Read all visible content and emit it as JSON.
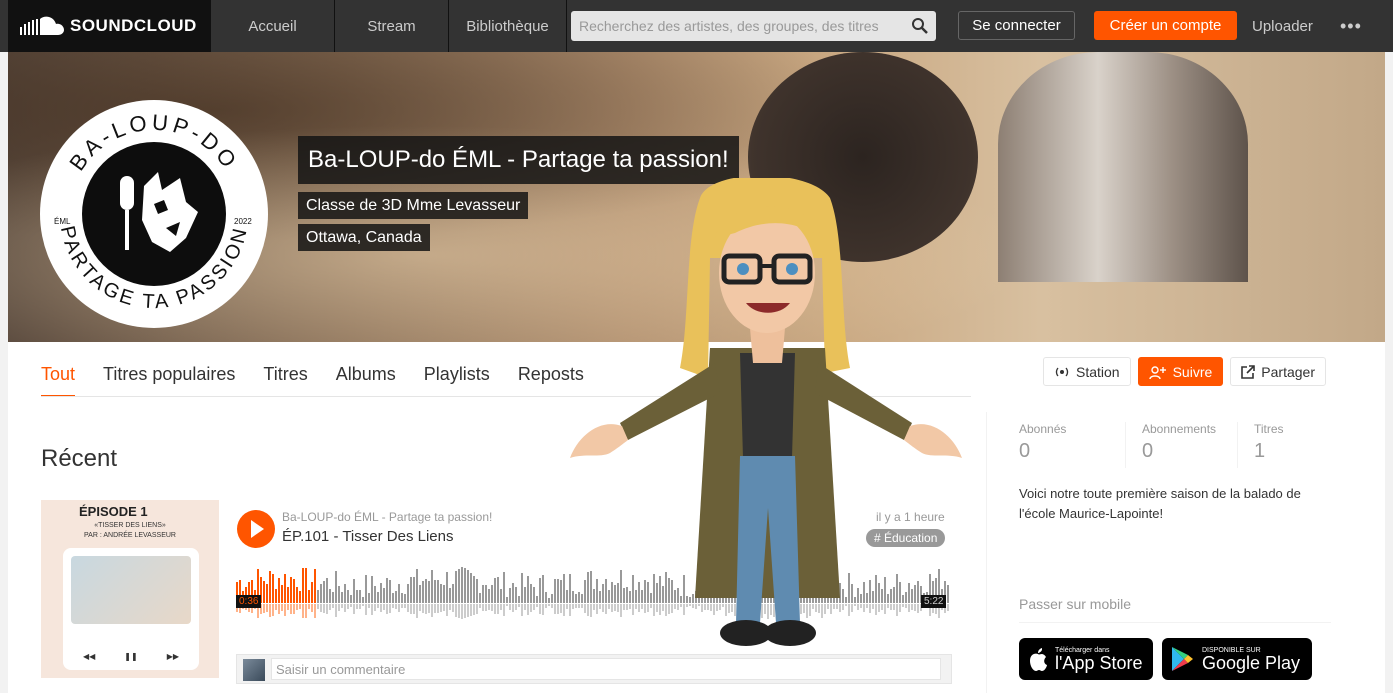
{
  "colors": {
    "accent": "#ff5500",
    "header_bg": "#333333",
    "logo_bg": "#111111"
  },
  "header": {
    "brand": "SOUNDCLOUD",
    "nav": [
      "Accueil",
      "Stream",
      "Bibliothèque"
    ],
    "search_placeholder": "Recherchez des artistes, des groupes, des titres",
    "login": "Se connecter",
    "signup": "Créer un compte",
    "upload": "Uploader",
    "more": "•••"
  },
  "banner": {
    "title": "Ba-LOUP-do ÉML - Partage ta passion!",
    "subtitle": "Classe de 3D Mme Levasseur",
    "location": "Ottawa, Canada",
    "logo": {
      "ring_top": "BA-LOUP-DO",
      "ring_bottom": "PARTAGE TA PASSION",
      "left": "ÉML",
      "right": "2022"
    }
  },
  "tabs": [
    {
      "label": "Tout",
      "active": true
    },
    {
      "label": "Titres populaires"
    },
    {
      "label": "Titres"
    },
    {
      "label": "Albums"
    },
    {
      "label": "Playlists"
    },
    {
      "label": "Reposts"
    }
  ],
  "actions": {
    "station": "Station",
    "follow": "Suivre",
    "share": "Partager"
  },
  "recent": {
    "heading": "Récent",
    "track": {
      "user": "Ba-LOUP-do ÉML - Partage ta passion!",
      "title": "ÉP.101 - Tisser Des Liens",
      "posted": "il y a 1 heure",
      "tag": "# Éducation",
      "current": "0:36",
      "duration": "5:22",
      "progress": 0.11,
      "artwork": {
        "episode": "ÉPISODE 1",
        "subtitle": "«TISSER DES LIENS»",
        "author": "PAR : ANDRÉE LEVASSEUR"
      }
    },
    "comment_placeholder": "Saisir un commentaire"
  },
  "sidebar": {
    "stats": [
      {
        "label": "Abonnés",
        "value": "0"
      },
      {
        "label": "Abonnements",
        "value": "0"
      },
      {
        "label": "Titres",
        "value": "1"
      }
    ],
    "bio": "Voici notre toute première saison de la balado de l'école Maurice-Lapointe!",
    "mobile": "Passer sur mobile",
    "app_store": {
      "small": "Télécharger dans",
      "big": "l'App Store"
    },
    "google_play": {
      "small": "DISPONIBLE SUR",
      "big": "Google Play"
    }
  }
}
